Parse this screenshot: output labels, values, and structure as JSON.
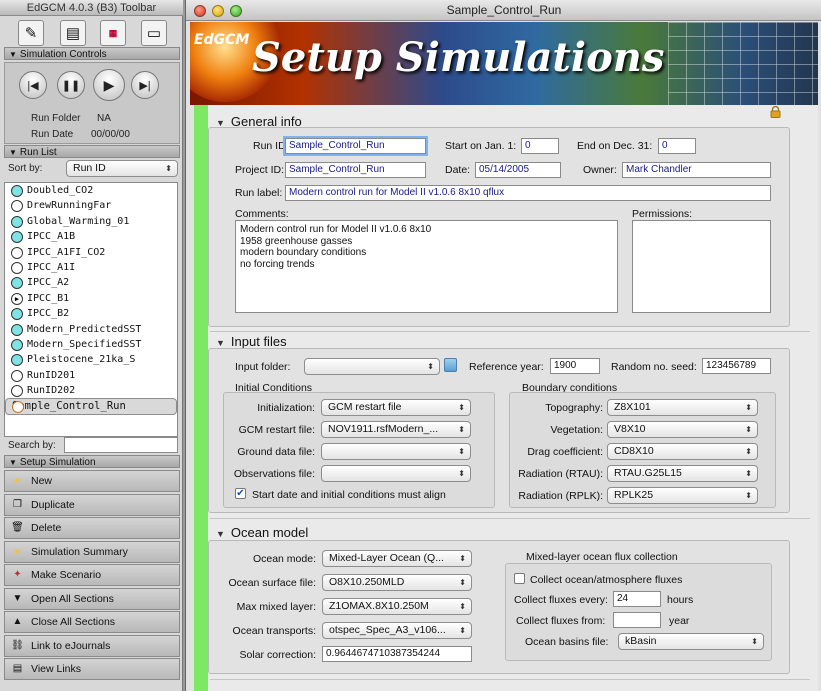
{
  "toolbar": {
    "title": "EdGCM 4.0.3 (B3) Toolbar",
    "tools": [
      "pencil-icon",
      "notes-icon",
      "data-table-icon",
      "monitor-icon"
    ],
    "simulation_controls": {
      "header": "Simulation Controls",
      "run_folder_label": "Run Folder",
      "run_folder_value": "NA",
      "run_date_label": "Run Date",
      "run_date_value": "00/00/00"
    },
    "run_list": {
      "header": "Run List",
      "sort_label": "Sort by:",
      "sort_value": "Run ID",
      "items": [
        {
          "name": "Doubled_CO2",
          "status": "cyan"
        },
        {
          "name": "DrewRunningFar",
          "status": "white"
        },
        {
          "name": "Global_Warming_01",
          "status": "cyan"
        },
        {
          "name": "IPCC_A1B",
          "status": "cyan"
        },
        {
          "name": "IPCC_A1FI_CO2",
          "status": "white"
        },
        {
          "name": "IPCC_A1I",
          "status": "white"
        },
        {
          "name": "IPCC_A2",
          "status": "cyan"
        },
        {
          "name": "IPCC_B1",
          "status": "playing"
        },
        {
          "name": "IPCC_B2",
          "status": "cyan"
        },
        {
          "name": "Modern_PredictedSST",
          "status": "cyan"
        },
        {
          "name": "Modern_SpecifiedSST",
          "status": "cyan"
        },
        {
          "name": "Pleistocene_21ka_S",
          "status": "cyan"
        },
        {
          "name": "RunID201",
          "status": "white"
        },
        {
          "name": "RunID202",
          "status": "white"
        },
        {
          "name": "Sample_Control_Run",
          "status": "selected"
        }
      ],
      "search_label": "Search by:",
      "search_value": ""
    },
    "setup_simulation": {
      "header": "Setup Simulation",
      "buttons": [
        {
          "label": "New",
          "icon": "new-folder-icon"
        },
        {
          "label": "Duplicate",
          "icon": "duplicate-icon"
        },
        {
          "label": "Delete",
          "icon": "trash-icon"
        },
        {
          "label": "Simulation Summary",
          "icon": "summary-icon"
        },
        {
          "label": "Make Scenario",
          "icon": "scenario-icon"
        },
        {
          "label": "Open All Sections",
          "icon": "expand-icon"
        },
        {
          "label": "Close All Sections",
          "icon": "collapse-icon"
        },
        {
          "label": "Link to eJournals",
          "icon": "link-icon"
        },
        {
          "label": "View Links",
          "icon": "links-icon"
        }
      ]
    }
  },
  "window": {
    "title": "Sample_Control_Run",
    "banner_brand": "EdGCM",
    "banner_title": "Setup Simulations"
  },
  "general_info": {
    "header": "General info",
    "run_id_label": "Run ID:",
    "run_id": "Sample_Control_Run",
    "start_label": "Start on Jan. 1:",
    "start_value": "0",
    "end_label": "End on Dec. 31:",
    "end_value": "0",
    "project_id_label": "Project ID:",
    "project_id": "Sample_Control_Run",
    "date_label": "Date:",
    "date_value": "05/14/2005",
    "owner_label": "Owner:",
    "owner_value": "Mark Chandler",
    "run_label_label": "Run label:",
    "run_label_value": "Modern control run for Model II v1.0.6 8x10 qflux",
    "comments_label": "Comments:",
    "comments": "Modern control run for Model II v1.0.6 8x10\n1958 greenhouse gasses\nmodern boundary conditions\nno forcing trends",
    "permissions_label": "Permissions:"
  },
  "input_files": {
    "header": "Input files",
    "input_folder_label": "Input folder:",
    "input_folder_value": "",
    "reference_year_label": "Reference year:",
    "reference_year": "1900",
    "seed_label": "Random no. seed:",
    "seed": "123456789",
    "initial_conditions": {
      "header": "Initial Conditions",
      "rows": [
        {
          "label": "Initialization:",
          "value": "GCM restart file"
        },
        {
          "label": "GCM restart file:",
          "value": "NOV1911.rsfModern_..."
        },
        {
          "label": "Ground data file:",
          "value": ""
        },
        {
          "label": "Observations file:",
          "value": ""
        }
      ],
      "checkbox_label": "Start date and initial conditions must align",
      "checkbox_checked": true
    },
    "boundary_conditions": {
      "header": "Boundary conditions",
      "rows": [
        {
          "label": "Topography:",
          "value": "Z8X101"
        },
        {
          "label": "Vegetation:",
          "value": "V8X10"
        },
        {
          "label": "Drag coefficient:",
          "value": "CD8X10"
        },
        {
          "label": "Radiation (RTAU):",
          "value": "RTAU.G25L15"
        },
        {
          "label": "Radiation (RPLK):",
          "value": "RPLK25"
        }
      ]
    }
  },
  "ocean_model": {
    "header": "Ocean model",
    "rows": [
      {
        "label": "Ocean mode:",
        "value": "Mixed-Layer Ocean (Q..."
      },
      {
        "label": "Ocean surface file:",
        "value": "O8X10.250MLD"
      },
      {
        "label": "Max mixed layer:",
        "value": "Z1OMAX.8X10.250M"
      },
      {
        "label": "Ocean transports:",
        "value": "otspec_Spec_A3_v106..."
      },
      {
        "label": "Solar correction:",
        "value": "0.9644674710387354244"
      }
    ],
    "flux": {
      "header": "Mixed-layer ocean flux collection",
      "checkbox_label": "Collect ocean/atmosphere fluxes",
      "checkbox_checked": false,
      "every_label": "Collect fluxes every:",
      "every_value": "24",
      "every_unit": "hours",
      "from_label": "Collect fluxes from:",
      "from_value": "",
      "from_unit": "year",
      "basins_label": "Ocean basins file:",
      "basins_value": "kBasin"
    }
  }
}
